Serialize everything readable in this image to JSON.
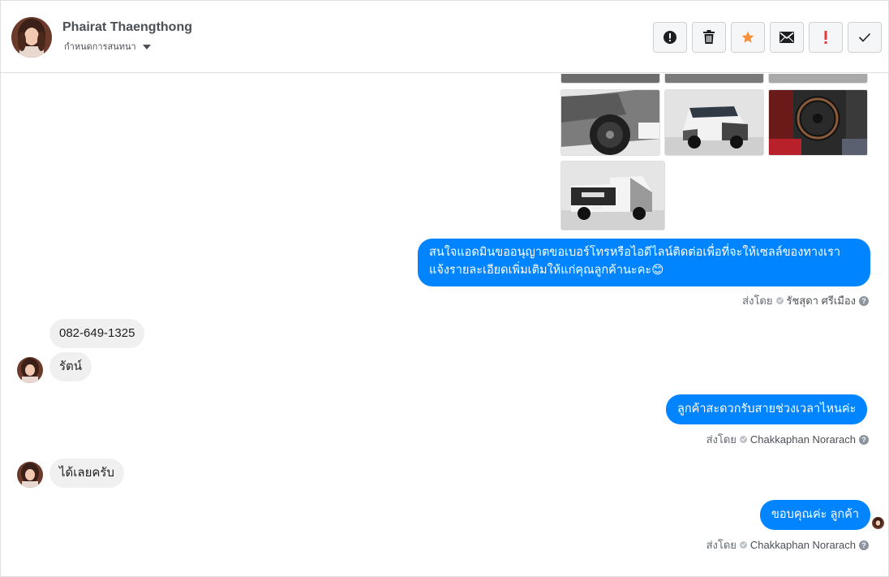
{
  "header": {
    "contact_name": "Phairat Thaengthong",
    "label_dropdown": "กำหนดการสนทนา"
  },
  "toolbar": {
    "buttons": [
      {
        "name": "report-button",
        "icon": "alert-circle-icon"
      },
      {
        "name": "delete-button",
        "icon": "trash-icon"
      },
      {
        "name": "star-button",
        "icon": "star-icon",
        "color": "#f7923b"
      },
      {
        "name": "mark-unread-button",
        "icon": "envelope-icon"
      },
      {
        "name": "important-button",
        "icon": "exclamation-icon",
        "color": "#e03a3a"
      },
      {
        "name": "done-button",
        "icon": "check-icon"
      }
    ]
  },
  "messages": {
    "agent_msg_1": "สนใจแอดมินขออนุญาตขอเบอร์โทรหรือไอดีไลน์ติดต่อเพื่อที่จะให้เซลล์ของทางเราแจ้งรายละเอียดเพิ่มเติมให้แก่คุณลูกค้านะคะ😊",
    "sent_by_label": "ส่งโดย",
    "sender_1": "รัชสุดา ศรีเมือง",
    "customer_msg_1": "082-649-1325",
    "customer_msg_2": "รัตน์",
    "agent_msg_2": "ลูกค้าสะดวกรับสายช่วงเวลาไหนค่ะ",
    "sender_2": "Chakkaphan Norarach",
    "customer_msg_3": "ได้เลยครับ",
    "agent_msg_3": "ขอบคุณค่ะ ลูกค้า",
    "sender_3": "Chakkaphan Norarach",
    "help_glyph": "?"
  },
  "colors": {
    "outgoing_bubble": "#0084ff",
    "incoming_bubble": "#f1f0f0",
    "border": "#dddfe2"
  }
}
